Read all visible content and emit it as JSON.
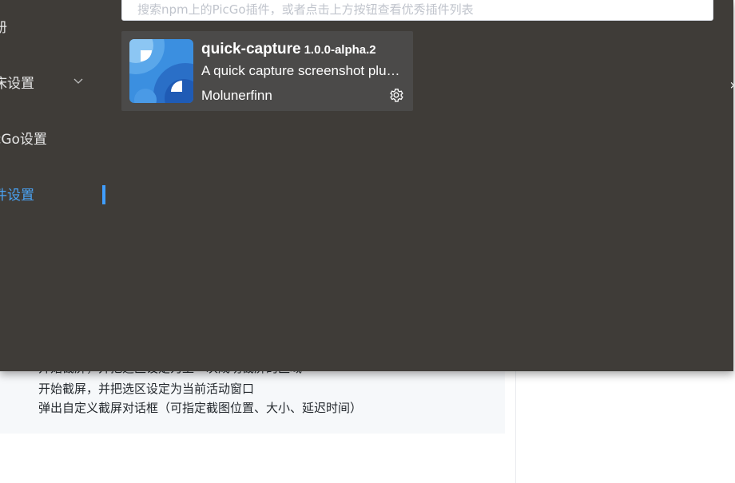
{
  "background": {
    "code_lines": [
      "开始截屏，并把选区设定为上一次成功截屏的区域",
      "开始截屏，并把选区设定为当前活动窗口",
      "弹出自定义截屏对话框（可指定截图位置、大小、延迟时间）"
    ]
  },
  "sidebar": {
    "items": [
      {
        "label": "册"
      },
      {
        "label": "床设置"
      },
      {
        "label": "cGo设置"
      },
      {
        "label": "件设置"
      }
    ],
    "active_color": "#409eff"
  },
  "search": {
    "placeholder": "搜索npm上的PicGo插件，或者点击上方按钮查看优秀插件列表"
  },
  "plugin_card": {
    "name": "quick-capture",
    "version": "1.0.0-alpha.2",
    "description": "A quick capture screenshot plugin for PicGo",
    "author": "Molunerfinn",
    "icon": "gear-icon"
  },
  "colors": {
    "app_bg": "#3f3c38",
    "card_bg": "#4b4a49",
    "accent": "#409eff"
  }
}
